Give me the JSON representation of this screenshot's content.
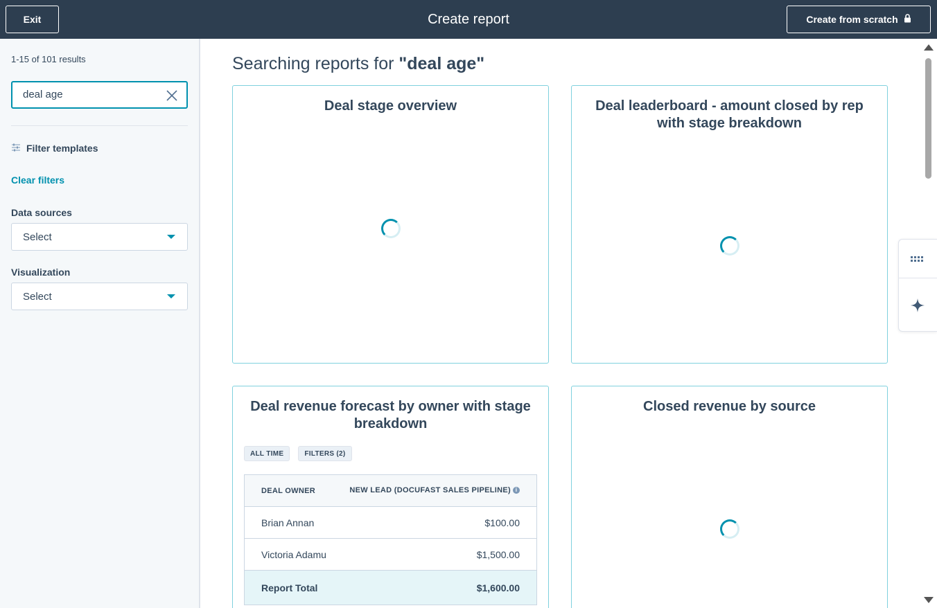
{
  "topbar": {
    "exit_label": "Exit",
    "title": "Create report",
    "create_scratch_label": "Create from scratch"
  },
  "sidebar": {
    "results_count": "1-15 of 101 results",
    "search_value": "deal age",
    "filter_templates_label": "Filter templates",
    "clear_filters_label": "Clear filters",
    "data_sources_label": "Data sources",
    "data_sources_value": "Select",
    "visualization_label": "Visualization",
    "visualization_value": "Select"
  },
  "main": {
    "heading_prefix": "Searching reports for ",
    "heading_query": "\"deal age\"",
    "cards": [
      {
        "title": "Deal stage overview",
        "state": "loading"
      },
      {
        "title": "Deal leaderboard - amount closed by rep with stage breakdown",
        "state": "loading"
      },
      {
        "title": "Deal revenue forecast by owner with stage breakdown",
        "chips": [
          "ALL TIME",
          "FILTERS (2)"
        ],
        "table": {
          "headers": [
            "DEAL OWNER",
            "NEW LEAD (DOCUFAST SALES PIPELINE)"
          ],
          "rows": [
            [
              "Brian Annan",
              "$100.00"
            ],
            [
              "Victoria Adamu",
              "$1,500.00"
            ]
          ],
          "total": [
            "Report Total",
            "$1,600.00"
          ]
        }
      },
      {
        "title": "Closed revenue by source",
        "state": "loading"
      }
    ]
  },
  "icons": {
    "search_clear": "close-icon",
    "filter": "sliders-icon",
    "lock": "lock-icon",
    "apps": "grid-dots-icon",
    "ai": "sparkle-icon",
    "info": "info-icon"
  },
  "colors": {
    "topbar_bg": "#2d3e50",
    "accent": "#0091ae",
    "card_border": "#7fd1de",
    "sidebar_bg": "#f5f8fa",
    "total_row_bg": "#e5f5f8",
    "text": "#33475b"
  }
}
